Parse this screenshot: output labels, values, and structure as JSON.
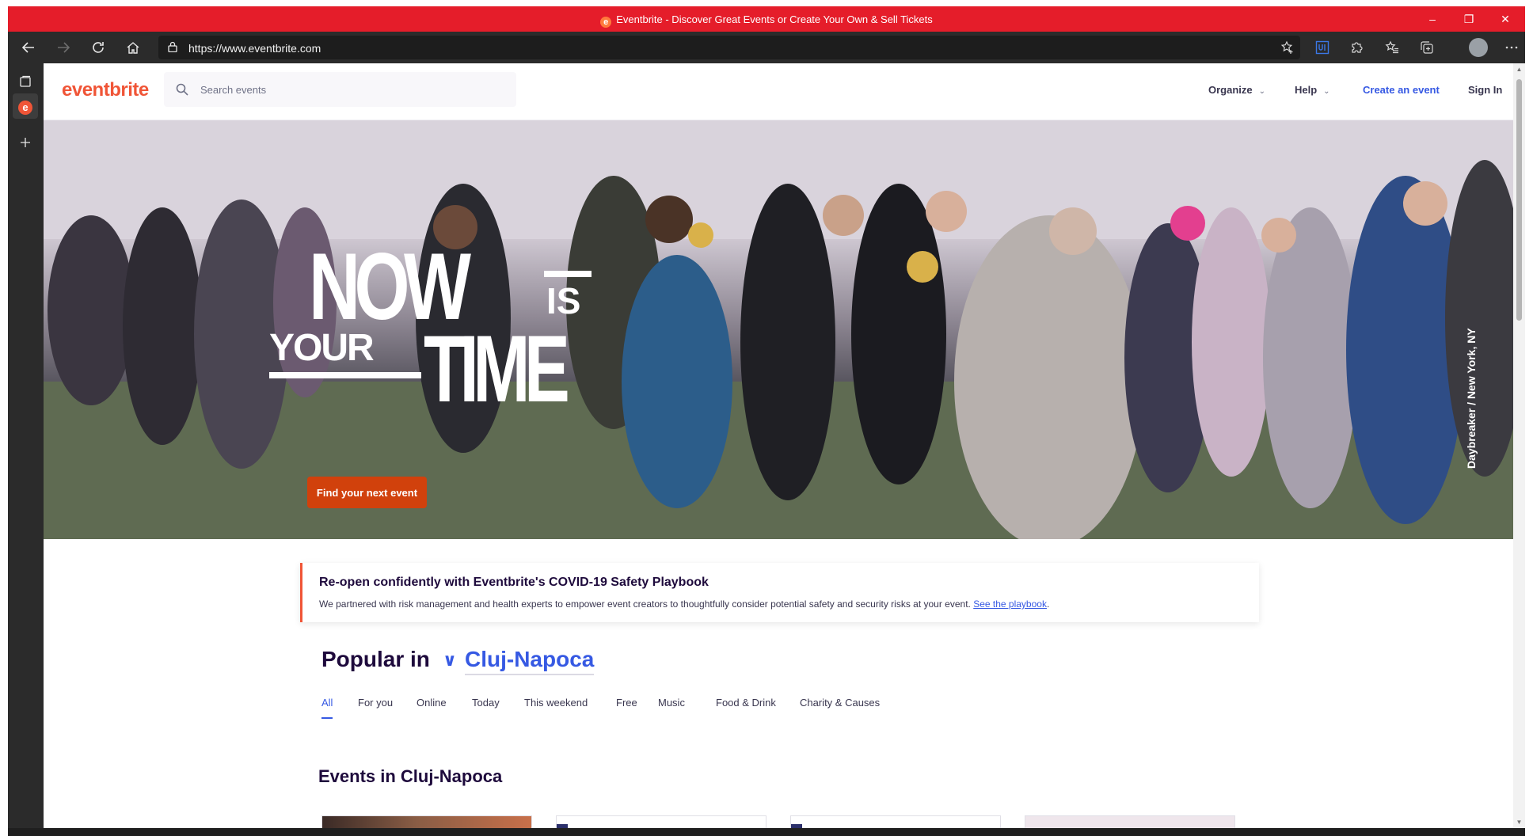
{
  "browser": {
    "window_title": "Eventbrite - Discover Great Events or Create Your Own & Sell Tickets",
    "url": "https://www.eventbrite.com",
    "title_icon": "e",
    "controls": {
      "minimize": "–",
      "restore": "❐",
      "close": "✕"
    },
    "colors": {
      "title_bar": "#e51d2a",
      "toolbar": "#2b2b2b"
    }
  },
  "vertical_tabs": {
    "tab_icon_letter": "e"
  },
  "site": {
    "brand": "eventbrite",
    "search": {
      "placeholder": "Search events"
    },
    "nav": {
      "organize": "Organize",
      "help": "Help",
      "create": "Create an event",
      "signin": "Sign In"
    },
    "colors": {
      "brand": "#f05537",
      "link": "#3659e3",
      "cta": "#d1410c"
    }
  },
  "hero": {
    "line_now": "NOW",
    "line_is": "IS",
    "line_your": "YOUR",
    "line_time": "TIME",
    "cta": "Find your next event",
    "credit": "Daybreaker / New York, NY"
  },
  "notice": {
    "title": "Re-open confidently with Eventbrite's COVID-19 Safety Playbook",
    "body": "We partnered with risk management and health experts to empower event creators to thoughtfully consider potential safety and security risks at your event.",
    "link": "See the playbook",
    "trailing": "."
  },
  "popular": {
    "label": "Popular in",
    "city": "Cluj-Napoca",
    "tabs": [
      {
        "label": "All"
      },
      {
        "label": "For you"
      },
      {
        "label": "Online"
      },
      {
        "label": "Today"
      },
      {
        "label": "This weekend"
      },
      {
        "label": "Free"
      },
      {
        "label": "Music"
      },
      {
        "label": "Food & Drink"
      },
      {
        "label": "Charity & Causes"
      }
    ],
    "active_tab": "All"
  },
  "events": {
    "heading": "Events in Cluj-Napoca"
  }
}
